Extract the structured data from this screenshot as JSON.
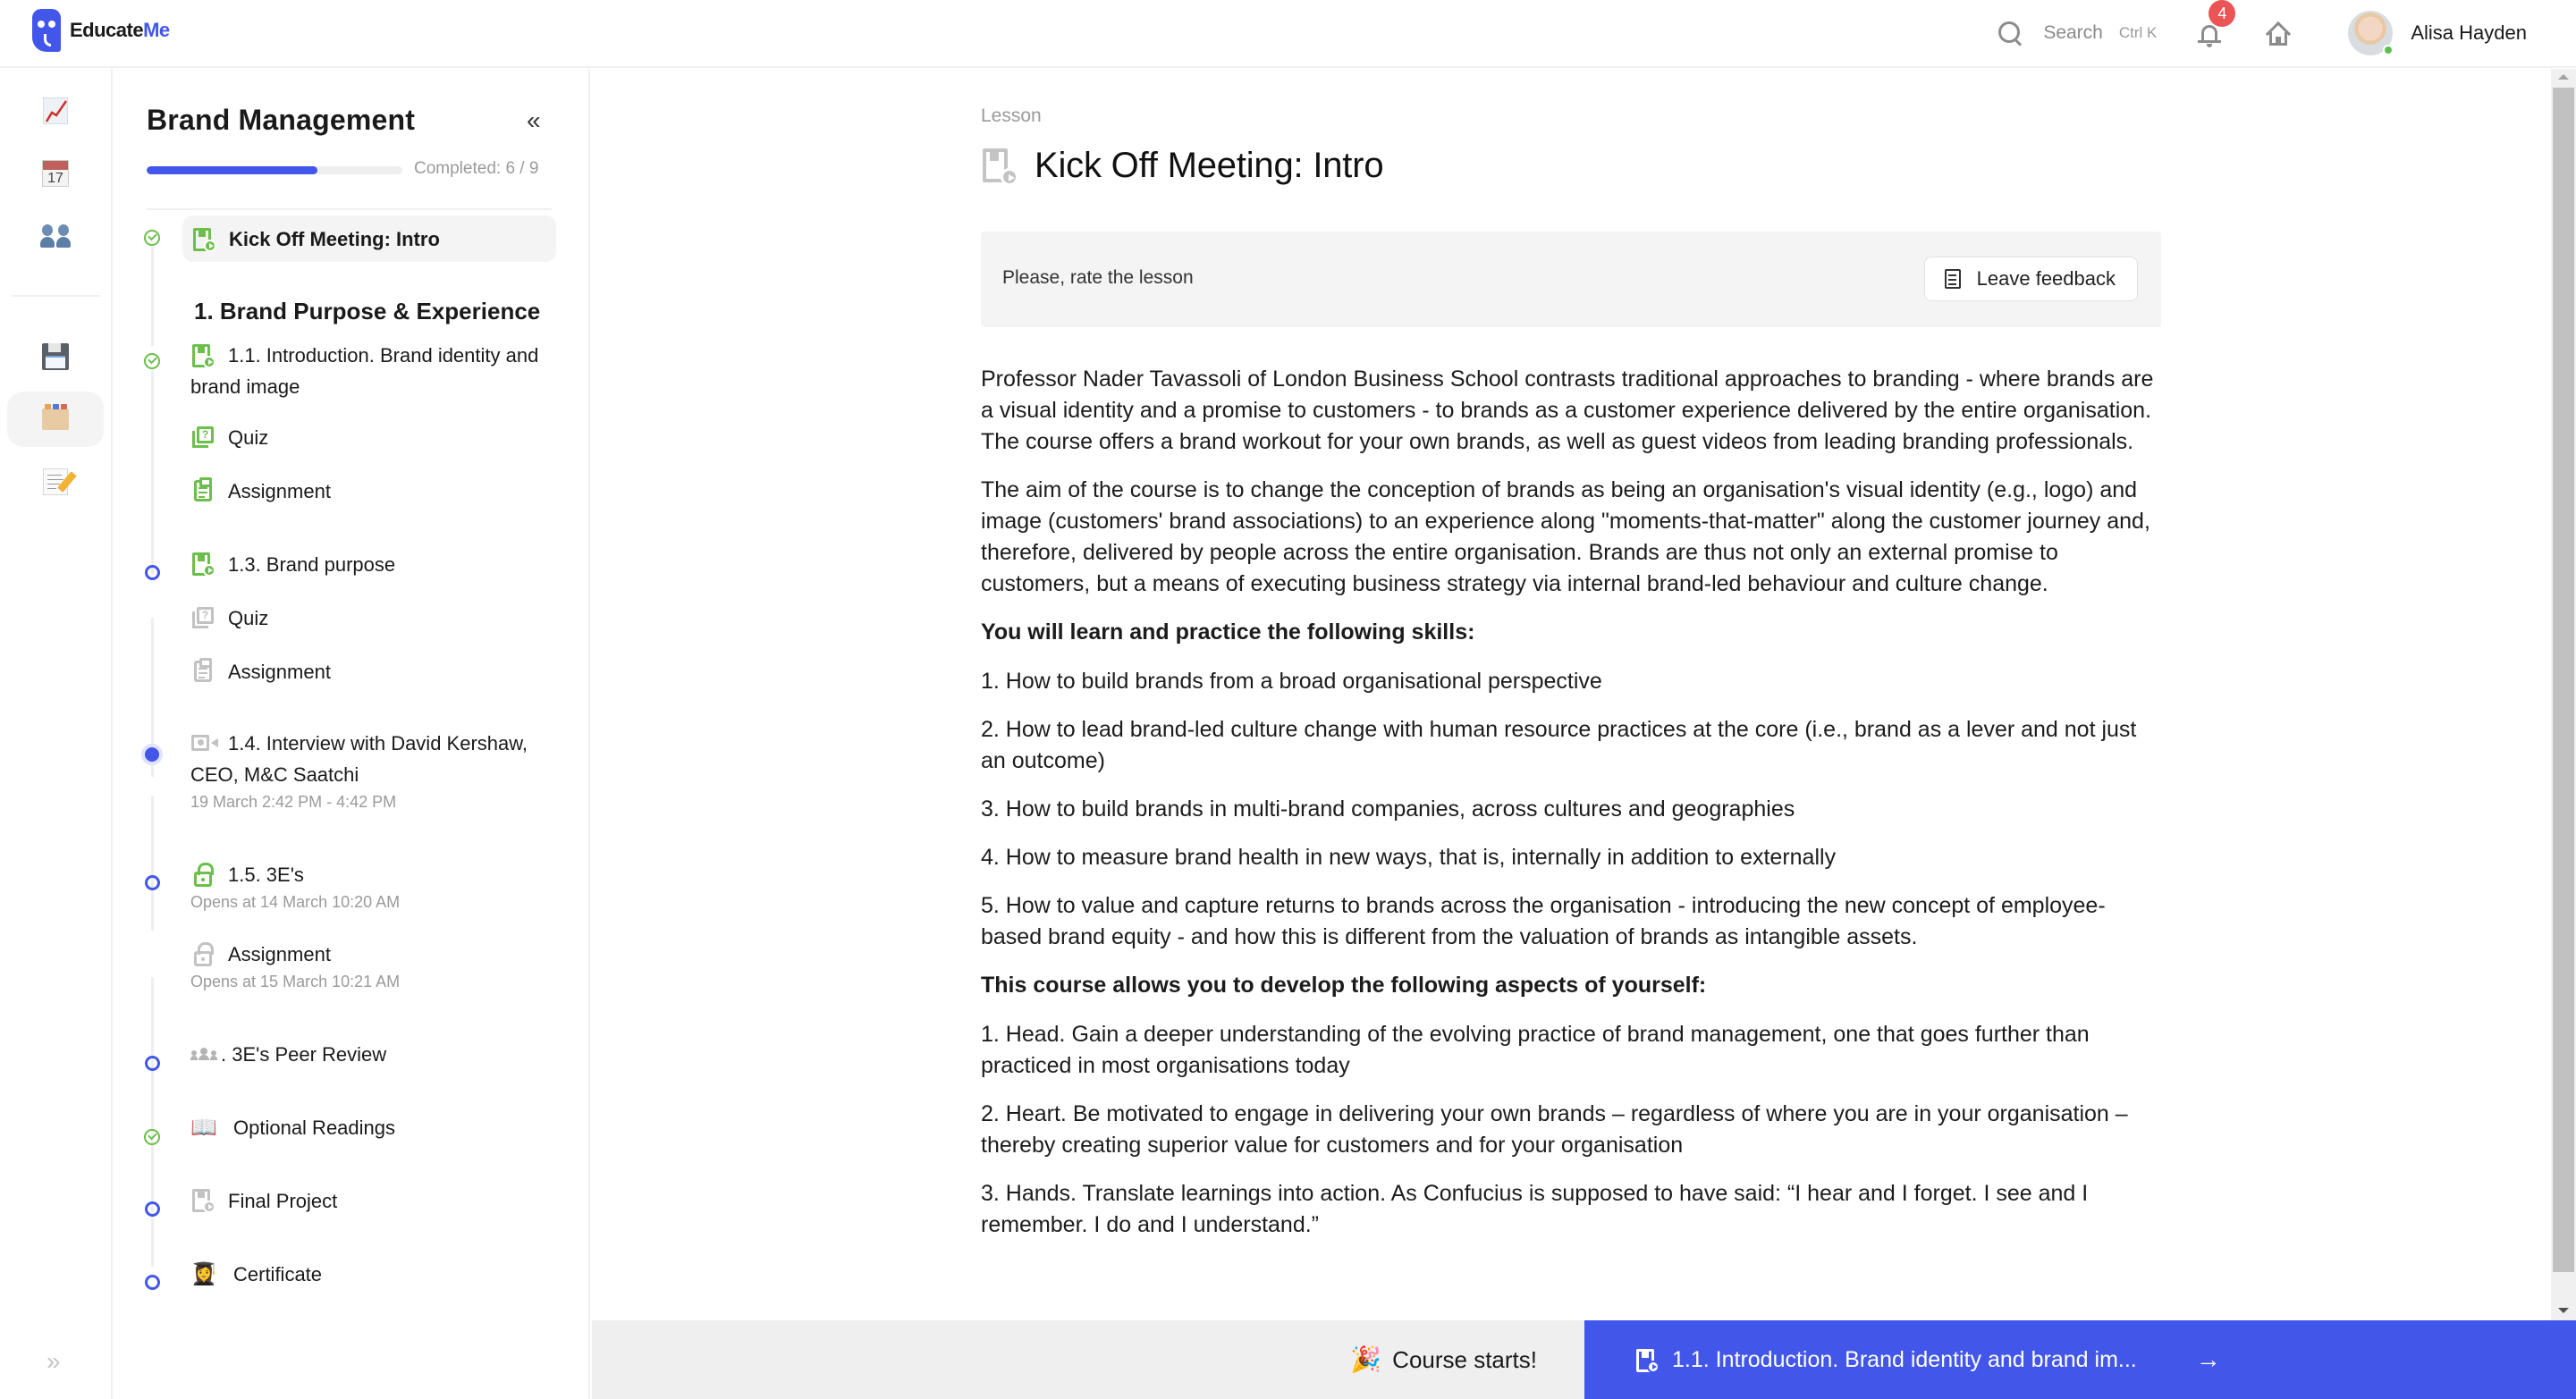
{
  "app": {
    "brand_main": "Educate",
    "brand_accent": "Me",
    "accent_color": "#4257ea"
  },
  "header": {
    "search_label": "Search",
    "search_shortcut": "Ctrl K",
    "notifications_count": "4",
    "user_name": "Alisa Hayden",
    "icons": [
      "search-icon",
      "bell-icon",
      "home-icon",
      "avatar"
    ]
  },
  "rail": {
    "items": [
      {
        "name": "chart-increasing-icon",
        "active": false
      },
      {
        "name": "calendar-icon",
        "label": "17",
        "active": false
      },
      {
        "name": "people-icon",
        "active": false
      },
      {
        "name": "floppy-disk-icon",
        "active": false
      },
      {
        "name": "card-file-box-icon",
        "active": true
      },
      {
        "name": "memo-icon",
        "active": false
      }
    ],
    "expand_glyph": "»"
  },
  "sidebar": {
    "title": "Brand Management",
    "collapse_glyph": "«",
    "progress": {
      "completed": 6,
      "total": 9,
      "label": "Completed: 6 / 9"
    },
    "section_title": "1. Brand Purpose & Experience",
    "items": [
      {
        "label": "Kick Off Meeting: Intro",
        "icon": "lesson",
        "status": "done",
        "active": true
      },
      {
        "label": "1.1. Introduction. Brand identity and brand image",
        "icon": "lesson",
        "status": "done"
      },
      {
        "label": "Quiz",
        "icon": "quiz",
        "status": "done-child"
      },
      {
        "label": "Assignment",
        "icon": "assignment",
        "status": "done-child"
      },
      {
        "label": "1.3. Brand purpose",
        "icon": "lesson",
        "status": "open"
      },
      {
        "label": "Quiz",
        "icon": "quiz",
        "status": "open-child"
      },
      {
        "label": "Assignment",
        "icon": "assignment",
        "status": "open-child"
      },
      {
        "label": "1.4. Interview with David Kershaw, CEO, M&C Saatchi",
        "sub": "19 March 2:42 PM - 4:42 PM",
        "icon": "video",
        "status": "current"
      },
      {
        "label": "1.5. 3E's",
        "sub": "Opens at 14 March 10:20 AM",
        "icon": "lock",
        "status": "open"
      },
      {
        "label": "Assignment",
        "sub": "Opens at 15 March 10:21 AM",
        "icon": "lock",
        "status": "locked-child"
      },
      {
        "label": ". 3E's Peer Review",
        "icon": "peer-review",
        "status": "open"
      },
      {
        "label": "Optional Readings",
        "icon": "open-book",
        "emoji": "📖",
        "status": "done"
      },
      {
        "label": "Final Project",
        "icon": "lesson",
        "status": "open"
      },
      {
        "label": "Certificate",
        "icon": "graduate",
        "emoji": "👩‍🎓",
        "status": "open"
      }
    ]
  },
  "lesson": {
    "eyebrow": "Lesson",
    "title": "Kick Off Meeting: Intro",
    "rate_prompt": "Please, rate the lesson",
    "feedback_button": "Leave feedback",
    "paragraphs": [
      "Professor Nader Tavassoli of London Business School contrasts traditional approaches to branding - where brands are a visual identity and a promise to customers - to brands as a customer experience delivered by the entire organisation. The course offers a brand workout for your own brands, as well as guest videos from leading branding professionals.",
      "The aim of the course is to change the conception of brands as being an organisation's visual identity (e.g., logo) and image (customers' brand associations) to an experience along \"moments-that-matter\" along the customer journey and, therefore, delivered by people across the entire organisation. Brands are thus not only an external promise to customers, but a means of executing business strategy via internal brand-led behaviour and culture change."
    ],
    "skills_heading": "You will learn and practice the following skills:",
    "skills": [
      "1. How to build brands from a broad organisational perspective",
      "2. How to lead brand-led culture change with human resource practices at the core (i.e., brand as a lever and not just an outcome)",
      "3. How to build brands in multi-brand companies, across cultures and geographies",
      "4. How to measure brand health in new ways, that is, internally in addition to externally",
      "5. How to value and capture returns to brands across the organisation - introducing the new concept of employee-based brand equity - and how this is different from the valuation of brands as intangible assets."
    ],
    "aspects_heading": "This course allows you to develop the following aspects of yourself:",
    "aspects": [
      "1. Head. Gain a deeper understanding of the evolving practice of brand management, one that goes further than practiced in most organisations today",
      "2. Heart. Be motivated to engage in delivering your own brands – regardless of where you are in your organisation – thereby creating superior value for customers and for your organisation",
      "3. Hands. Translate learnings into action. As Confucius is supposed to have said: “I hear and I forget. I see and I remember. I do and I understand.”"
    ]
  },
  "footer": {
    "prev_emoji": "🎉",
    "prev_label": "Course starts!",
    "next_label": "1.1. Introduction. Brand identity and brand im...",
    "next_arrow": "→"
  }
}
